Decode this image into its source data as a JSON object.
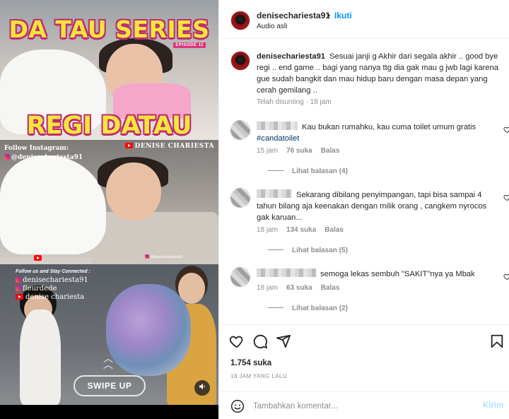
{
  "media": {
    "title_top": "DA TAU SERIES",
    "episode": "EPISODE 11",
    "title_bottom": "REGI DATAU",
    "follow_instagram": "Follow Instagram:",
    "instagram_handle": "@denisechariesta91",
    "youtube_channel": "DENISE CHARIESTA",
    "small_ig_handle": "@denisechariesta91",
    "follow_connected": "Follow us and Stay Connected :",
    "social_lines": [
      "denisechariesta91",
      "fleurdede",
      "denise chariesta"
    ],
    "swipe_label": "SWIPE UP"
  },
  "header": {
    "username": "denisechariesta91",
    "dot": "•",
    "follow_label": "Ikuti",
    "audio": "Audio asli"
  },
  "caption": {
    "username": "denisechariesta91",
    "text": "Sesuai janji g Akhir dari segala akhir .. good bye regi .. end game .. bagi yang nanya ttg dia gak mau g jwb lagi karena gue sudah bangkit dan mau hidup baru dengan masa depan yang cerah gemilang ..",
    "meta": "Telah disunting · 18 jam"
  },
  "comments": [
    {
      "text": "Kau bukan rumahku, kau cuma toilet umum gratis",
      "hashtag": "#candatoilet",
      "time": "15 jam",
      "likes": "76 suka",
      "reply": "Balas",
      "view_replies": "Lihat balasan (4)"
    },
    {
      "text": "Sekarang dibilang penyimpangan, tapi bisa sampai 4 tahun bilang aja keenakan dengan milik orang , cangkem nyrocos gak karuan...",
      "time": "18 jam",
      "likes": "134 suka",
      "reply": "Balas",
      "view_replies": "Lihat balasan (5)"
    },
    {
      "text": "semoga lekas sembuh \"SAKIT\"nya ya Mbak",
      "time": "18 jam",
      "likes": "63 suka",
      "reply": "Balas",
      "view_replies": "Lihat balasan (2)"
    }
  ],
  "actions": {
    "likes": "1.754 suka",
    "time_ago": "18 JAM YANG LALU"
  },
  "add_comment": {
    "placeholder": "Tambahkan komentar...",
    "post_label": "Kirim"
  },
  "colors": {
    "accent_blue": "#0095f6",
    "post_disabled": "#b2dffc",
    "muted_text": "#8e8e8e",
    "hashtag": "#00376b",
    "title_yellow": "#f6e63b",
    "title_outline": "#c02b72"
  },
  "icons": [
    "heart-icon",
    "comment-icon",
    "share-icon",
    "bookmark-icon",
    "emoji-icon",
    "sound-icon",
    "swipe-chevron-icon"
  ]
}
